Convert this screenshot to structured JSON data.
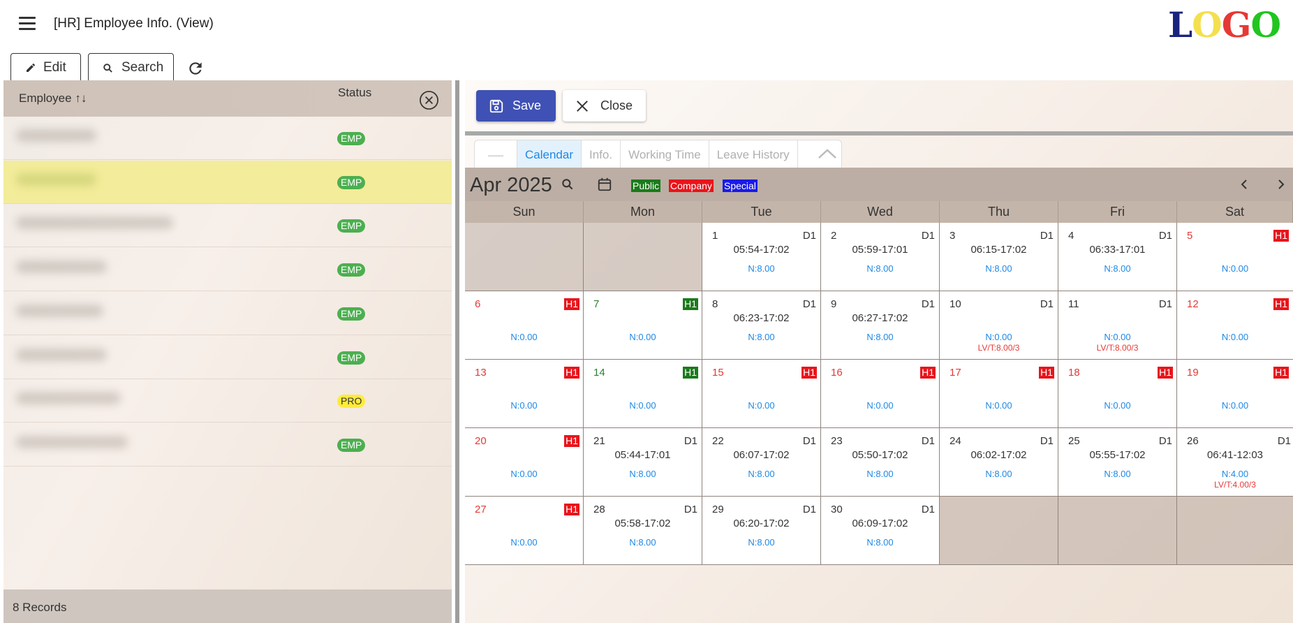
{
  "header": {
    "title": "[HR] Employee Info. (View)"
  },
  "logo": {
    "letters": [
      {
        "ch": "L",
        "color": "#1a237e"
      },
      {
        "ch": "O",
        "color": "#f4e04d"
      },
      {
        "ch": "G",
        "color": "#e53935"
      },
      {
        "ch": "O",
        "color": "#21c521"
      }
    ]
  },
  "toolbar": {
    "edit_label": "Edit",
    "search_label": "Search"
  },
  "employee_list": {
    "col_employee": "Employee ↑↓",
    "col_status": "Status",
    "rows": [
      {
        "status": "EMP"
      },
      {
        "status": "EMP",
        "selected": true
      },
      {
        "status": "EMP"
      },
      {
        "status": "EMP"
      },
      {
        "status": "EMP"
      },
      {
        "status": "EMP"
      },
      {
        "status": "PRO"
      },
      {
        "status": "EMP"
      }
    ],
    "footer": "8  Records"
  },
  "actions": {
    "save_label": "Save",
    "close_label": "Close"
  },
  "tabs": {
    "collapse": "—",
    "items": [
      "Calendar",
      "Info.",
      "Working Time",
      "Leave History"
    ],
    "active": "Calendar"
  },
  "calendar": {
    "month_label": "Apr 2025",
    "legend": [
      {
        "label": "Public",
        "color": "#1b7a1b"
      },
      {
        "label": "Company",
        "color": "#e8141b"
      },
      {
        "label": "Special",
        "color": "#1a1ae6"
      }
    ],
    "weekdays": [
      "Sun",
      "Mon",
      "Tue",
      "Wed",
      "Thu",
      "Fri",
      "Sat"
    ],
    "weeks": [
      [
        null,
        null,
        {
          "day": "1",
          "tag": "D1",
          "time": "05:54-17:02",
          "norm": "N:8.00"
        },
        {
          "day": "2",
          "tag": "D1",
          "time": "05:59-17:01",
          "norm": "N:8.00"
        },
        {
          "day": "3",
          "tag": "D1",
          "time": "06:15-17:02",
          "norm": "N:8.00"
        },
        {
          "day": "4",
          "tag": "D1",
          "time": "06:33-17:01",
          "norm": "N:8.00"
        },
        {
          "day": "5",
          "tag": "H1",
          "tagColor": "#e8141b",
          "dayColor": "red",
          "norm": "N:0.00"
        }
      ],
      [
        {
          "day": "6",
          "tag": "H1",
          "tagColor": "#e8141b",
          "dayColor": "red",
          "norm": "N:0.00"
        },
        {
          "day": "7",
          "tag": "H1",
          "tagColor": "#1b7a1b",
          "dayColor": "green",
          "norm": "N:0.00"
        },
        {
          "day": "8",
          "tag": "D1",
          "time": "06:23-17:02",
          "norm": "N:8.00"
        },
        {
          "day": "9",
          "tag": "D1",
          "time": "06:27-17:02",
          "norm": "N:8.00"
        },
        {
          "day": "10",
          "tag": "D1",
          "norm": "N:0.00",
          "leave": "LV/T:8.00/3"
        },
        {
          "day": "11",
          "tag": "D1",
          "norm": "N:0.00",
          "leave": "LV/T:8.00/3"
        },
        {
          "day": "12",
          "tag": "H1",
          "tagColor": "#e8141b",
          "dayColor": "red",
          "norm": "N:0.00"
        }
      ],
      [
        {
          "day": "13",
          "tag": "H1",
          "tagColor": "#e8141b",
          "dayColor": "red",
          "norm": "N:0.00"
        },
        {
          "day": "14",
          "tag": "H1",
          "tagColor": "#1b7a1b",
          "dayColor": "green",
          "norm": "N:0.00"
        },
        {
          "day": "15",
          "tag": "H1",
          "tagColor": "#e8141b",
          "dayColor": "red",
          "norm": "N:0.00"
        },
        {
          "day": "16",
          "tag": "H1",
          "tagColor": "#e8141b",
          "dayColor": "red",
          "norm": "N:0.00"
        },
        {
          "day": "17",
          "tag": "H1",
          "tagColor": "#e8141b",
          "dayColor": "red",
          "norm": "N:0.00"
        },
        {
          "day": "18",
          "tag": "H1",
          "tagColor": "#e8141b",
          "dayColor": "red",
          "norm": "N:0.00"
        },
        {
          "day": "19",
          "tag": "H1",
          "tagColor": "#e8141b",
          "dayColor": "red",
          "norm": "N:0.00"
        }
      ],
      [
        {
          "day": "20",
          "tag": "H1",
          "tagColor": "#e8141b",
          "dayColor": "red",
          "norm": "N:0.00"
        },
        {
          "day": "21",
          "tag": "D1",
          "time": "05:44-17:01",
          "norm": "N:8.00"
        },
        {
          "day": "22",
          "tag": "D1",
          "time": "06:07-17:02",
          "norm": "N:8.00"
        },
        {
          "day": "23",
          "tag": "D1",
          "time": "05:50-17:02",
          "norm": "N:8.00"
        },
        {
          "day": "24",
          "tag": "D1",
          "time": "06:02-17:02",
          "norm": "N:8.00"
        },
        {
          "day": "25",
          "tag": "D1",
          "time": "05:55-17:02",
          "norm": "N:8.00"
        },
        {
          "day": "26",
          "tag": "D1",
          "time": "06:41-12:03",
          "norm": "N:4.00",
          "leave": "LV/T:4.00/3"
        }
      ],
      [
        {
          "day": "27",
          "tag": "H1",
          "tagColor": "#e8141b",
          "dayColor": "red",
          "norm": "N:0.00"
        },
        {
          "day": "28",
          "tag": "D1",
          "time": "05:58-17:02",
          "norm": "N:8.00"
        },
        {
          "day": "29",
          "tag": "D1",
          "time": "06:20-17:02",
          "norm": "N:8.00"
        },
        {
          "day": "30",
          "tag": "D1",
          "time": "06:09-17:02",
          "norm": "N:8.00"
        },
        null,
        null,
        null
      ]
    ]
  }
}
